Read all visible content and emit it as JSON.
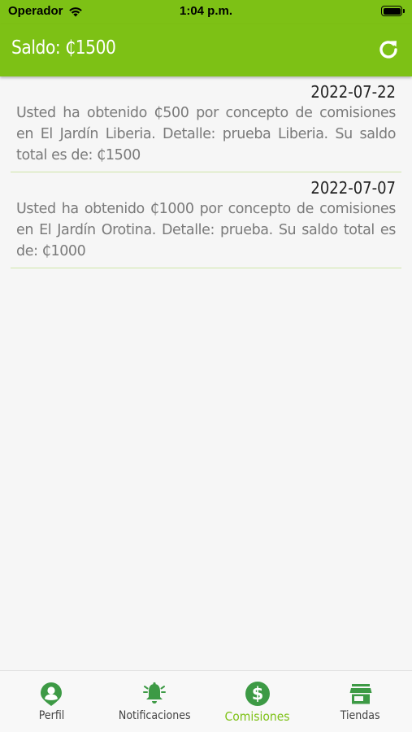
{
  "status_bar": {
    "carrier": "Operador",
    "time": "1:04 p.m."
  },
  "header": {
    "balance": "Saldo: ₵1500",
    "refresh_icon": "refresh-icon"
  },
  "commissions": [
    {
      "date": "2022-07-22",
      "message": "Usted ha obtenido ₵500 por concepto de comisiones en El Jardín Liberia. Detalle: prueba Liberia. Su saldo total es de: ₵1500"
    },
    {
      "date": "2022-07-07",
      "message": "Usted ha obtenido ₵1000 por concepto de comisiones en El Jardín Orotina. Detalle: prueba. Su saldo total es de: ₵1000"
    }
  ],
  "tabs": [
    {
      "label": "Perfil",
      "icon": "profile-icon"
    },
    {
      "label": "Notificaciones",
      "icon": "bell-icon"
    },
    {
      "label": "Comisiones",
      "icon": "dollar-icon",
      "active": true
    },
    {
      "label": "Tiendas",
      "icon": "store-icon"
    }
  ],
  "colors": {
    "brand": "#7dc115",
    "divider": "#cfe6a9",
    "tab_icon": "#3d9a45"
  }
}
